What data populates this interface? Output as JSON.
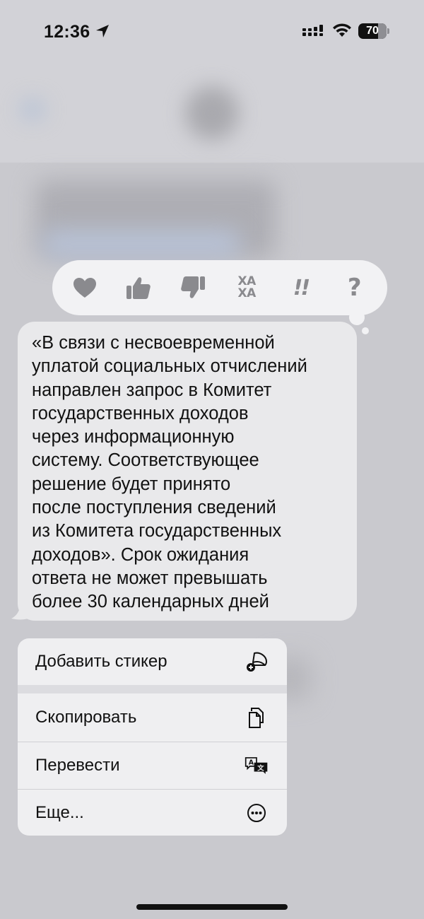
{
  "status_bar": {
    "time": "12:36",
    "battery_percent": "70",
    "battery_level": 0.7,
    "location_icon": "location-arrow-icon",
    "signal_icon": "cellular-signal-icon",
    "wifi_icon": "wifi-icon",
    "battery_icon": "battery-icon"
  },
  "tapbacks": [
    {
      "name": "heart",
      "icon": "heart-icon"
    },
    {
      "name": "thumbs-up",
      "icon": "thumbs-up-icon"
    },
    {
      "name": "thumbs-down",
      "icon": "thumbs-down-icon"
    },
    {
      "name": "haha",
      "icon": "haha-icon",
      "line1": "ХА",
      "line2": "ХА"
    },
    {
      "name": "emphasize",
      "icon": "double-exclamation-icon",
      "text": "!!"
    },
    {
      "name": "question",
      "icon": "question-mark-icon",
      "text": "?"
    }
  ],
  "message": {
    "text": "«В связи с несвоевременной\nуплатой социальных отчислений\nнаправлен запрос в Комитет\nгосударственных доходов\nчерез информационную\nсистему. Соответствующее\nрешение будет принято\nпосле поступления сведений\nиз Комитета государственных\nдоходов». Срок ожидания\nответа не может превышать\nболее 30 календарных дней"
  },
  "menu": {
    "add_sticker": {
      "label": "Добавить стикер",
      "icon": "add-sticker-icon"
    },
    "copy": {
      "label": "Скопировать",
      "icon": "copy-icon"
    },
    "translate": {
      "label": "Перевести",
      "icon": "translate-icon"
    },
    "more": {
      "label": "Еще...",
      "icon": "more-ellipsis-icon"
    }
  },
  "colors": {
    "background": "#c9c9ce",
    "bubble": "#e9e9eb",
    "tapback_bar": "#f2f2f4",
    "icon_gray": "#8a8a8e",
    "text": "#111111"
  }
}
